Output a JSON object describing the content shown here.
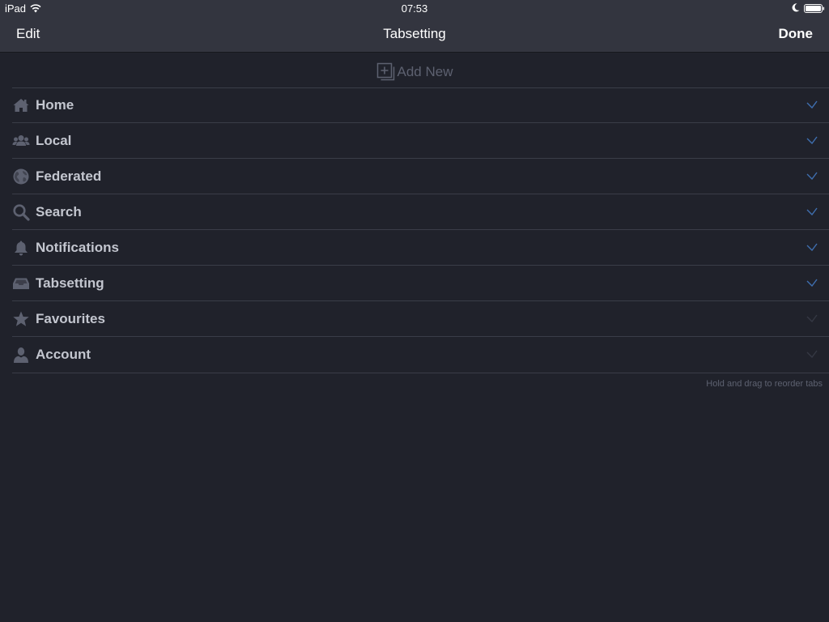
{
  "status_bar": {
    "device": "iPad",
    "time": "07:53",
    "icons": [
      "wifi-icon",
      "moon-icon",
      "battery-icon"
    ]
  },
  "nav": {
    "edit_label": "Edit",
    "title": "Tabsetting",
    "done_label": "Done"
  },
  "add_new": {
    "label": "Add New",
    "icon": "add-square-icon"
  },
  "tabs": [
    {
      "label": "Home",
      "icon": "home-icon",
      "checked": true
    },
    {
      "label": "Local",
      "icon": "users-icon",
      "checked": true
    },
    {
      "label": "Federated",
      "icon": "globe-icon",
      "checked": true
    },
    {
      "label": "Search",
      "icon": "search-icon",
      "checked": true
    },
    {
      "label": "Notifications",
      "icon": "bell-icon",
      "checked": true
    },
    {
      "label": "Tabsetting",
      "icon": "inbox-icon",
      "checked": true
    },
    {
      "label": "Favourites",
      "icon": "star-icon",
      "checked": false
    },
    {
      "label": "Account",
      "icon": "person-icon",
      "checked": false
    }
  ],
  "footer": {
    "hint": "Hold and drag to reorder tabs"
  },
  "colors": {
    "background": "#20222b",
    "bar": "#33353f",
    "label": "#c3c6cf",
    "icon": "#5d6170",
    "check_on": "#3f6fb0",
    "check_off": "#353844"
  }
}
